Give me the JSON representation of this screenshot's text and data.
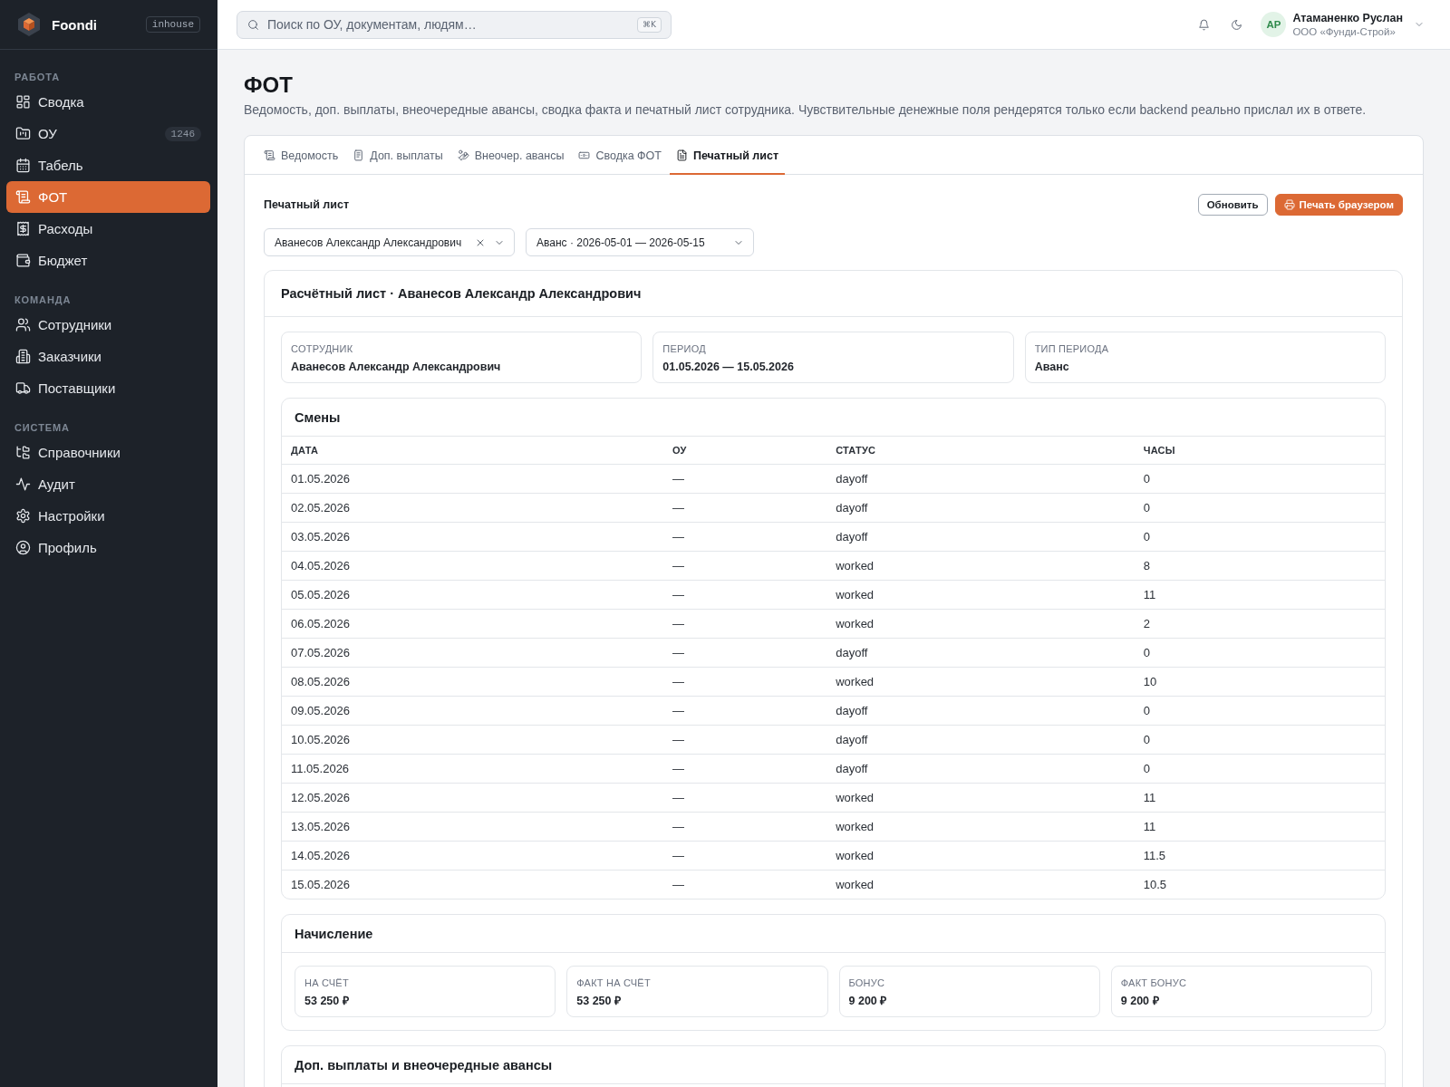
{
  "sidebar": {
    "brand": "Foondi",
    "env_badge": "inhouse",
    "groups": [
      {
        "title": "РАБОТА",
        "items": [
          {
            "label": "Сводка",
            "selected": false
          },
          {
            "label": "ОУ",
            "count": "1246",
            "selected": false
          },
          {
            "label": "Табель",
            "selected": false
          },
          {
            "label": "ФОТ",
            "selected": true
          },
          {
            "label": "Расходы",
            "selected": false
          },
          {
            "label": "Бюджет",
            "selected": false
          }
        ]
      },
      {
        "title": "КОМАНДА",
        "items": [
          {
            "label": "Сотрудники",
            "selected": false
          },
          {
            "label": "Заказчики",
            "selected": false
          },
          {
            "label": "Поставщики",
            "selected": false
          }
        ]
      },
      {
        "title": "СИСТЕМА",
        "items": [
          {
            "label": "Справочники",
            "selected": false
          },
          {
            "label": "Аудит",
            "selected": false
          },
          {
            "label": "Настройки",
            "selected": false
          },
          {
            "label": "Профиль",
            "selected": false
          }
        ]
      }
    ]
  },
  "topbar": {
    "search": {
      "placeholder": "Поиск по ОУ, документам, людям…",
      "shortcut": "⌘K"
    },
    "user": {
      "initials": "АР",
      "name": "Атаманенко Руслан",
      "org": "ООО «Фунди-Строй»"
    }
  },
  "page": {
    "title": "ФОТ",
    "description": "Ведомость, доп. выплаты, внеочередные авансы, сводка факта и печатный лист сотрудника. Чувствительные денежные поля рендерятся только если backend реально прислал их в ответе."
  },
  "tabs": [
    {
      "label": "Ведомость",
      "selected": false
    },
    {
      "label": "Доп. выплаты",
      "selected": false
    },
    {
      "label": "Внеочер. авансы",
      "selected": false
    },
    {
      "label": "Сводка ФОТ",
      "selected": false
    },
    {
      "label": "Печатный лист",
      "selected": true
    }
  ],
  "print_sheet": {
    "title": "Печатный лист",
    "buttons": [
      {
        "kind": "secondary",
        "label": "Обновить"
      },
      {
        "kind": "primary",
        "label": "Печать браузером"
      }
    ],
    "selects": [
      {
        "value": "Аванесов Александр Александрович",
        "clearable": true
      },
      {
        "value": "Аванс · 2026-05-01 — 2026-05-15",
        "clearable": false
      }
    ],
    "payslip": {
      "title": "Расчётный лист · Аванесов Александр Александрович",
      "fields": [
        {
          "label": "СОТРУДНИК",
          "value": "Аванесов Александр Александрович"
        },
        {
          "label": "ПЕРИОД",
          "value": "01.05.2026 — 15.05.2026"
        },
        {
          "label": "ТИП ПЕРИОДА",
          "value": "Аванс"
        }
      ],
      "shifts": {
        "title": "Смены",
        "columns": [
          "ДАТА",
          "ОУ",
          "СТАТУС",
          "ЧАСЫ"
        ],
        "rows": [
          [
            "01.05.2026",
            "—",
            "dayoff",
            "0"
          ],
          [
            "02.05.2026",
            "—",
            "dayoff",
            "0"
          ],
          [
            "03.05.2026",
            "—",
            "dayoff",
            "0"
          ],
          [
            "04.05.2026",
            "—",
            "worked",
            "8"
          ],
          [
            "05.05.2026",
            "—",
            "worked",
            "11"
          ],
          [
            "06.05.2026",
            "—",
            "worked",
            "2"
          ],
          [
            "07.05.2026",
            "—",
            "dayoff",
            "0"
          ],
          [
            "08.05.2026",
            "—",
            "worked",
            "10"
          ],
          [
            "09.05.2026",
            "—",
            "dayoff",
            "0"
          ],
          [
            "10.05.2026",
            "—",
            "dayoff",
            "0"
          ],
          [
            "11.05.2026",
            "—",
            "dayoff",
            "0"
          ],
          [
            "12.05.2026",
            "—",
            "worked",
            "11"
          ],
          [
            "13.05.2026",
            "—",
            "worked",
            "11"
          ],
          [
            "14.05.2026",
            "—",
            "worked",
            "11.5"
          ],
          [
            "15.05.2026",
            "—",
            "worked",
            "10.5"
          ]
        ]
      },
      "accrual": {
        "title": "Начисление",
        "fields": [
          {
            "label": "НА СЧЁТ",
            "value": "53 250 ₽"
          },
          {
            "label": "ФАКТ НА СЧЁТ",
            "value": "53 250 ₽"
          },
          {
            "label": "БОНУС",
            "value": "9 200 ₽"
          },
          {
            "label": "ФАКТ БОНУС",
            "value": "9 200 ₽"
          }
        ]
      },
      "extras": {
        "title": "Доп. выплаты и внеочередные авансы"
      }
    }
  }
}
